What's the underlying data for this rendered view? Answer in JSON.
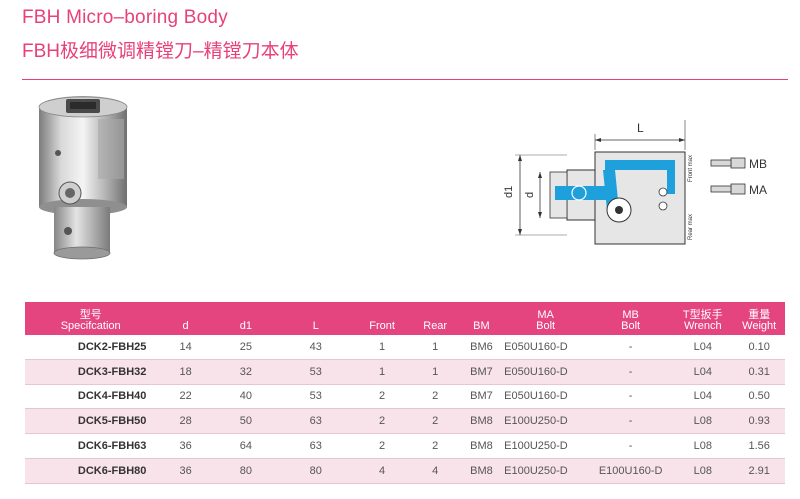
{
  "title_en": "FBH Micro–boring Body",
  "title_cn": "FBH极细微调精镗刀–精镗刀本体",
  "diagram": {
    "label_L": "L",
    "label_d1": "d1",
    "label_d": "d",
    "label_MB": "MB",
    "label_MA": "MA",
    "label_front_max": "Front max",
    "label_rear_max": "Rear max"
  },
  "table": {
    "headers": [
      {
        "cn": "型号",
        "en": "Specifcation"
      },
      {
        "cn": "",
        "en": "d"
      },
      {
        "cn": "",
        "en": "d1"
      },
      {
        "cn": "",
        "en": "L"
      },
      {
        "cn": "",
        "en": "Front"
      },
      {
        "cn": "",
        "en": "Rear"
      },
      {
        "cn": "",
        "en": "BM"
      },
      {
        "cn": "MA",
        "en": "Bolt"
      },
      {
        "cn": "MB",
        "en": "Bolt"
      },
      {
        "cn": "T型扳手",
        "en": "Wrench"
      },
      {
        "cn": "重量",
        "en": "Weight"
      }
    ],
    "rows": [
      [
        "DCK2-FBH25",
        "14",
        "25",
        "43",
        "1",
        "1",
        "BM6",
        "E050U160-D",
        "-",
        "L04",
        "0.10"
      ],
      [
        "DCK3-FBH32",
        "18",
        "32",
        "53",
        "1",
        "1",
        "BM7",
        "E050U160-D",
        "-",
        "L04",
        "0.31"
      ],
      [
        "DCK4-FBH40",
        "22",
        "40",
        "53",
        "2",
        "2",
        "BM7",
        "E050U160-D",
        "-",
        "L04",
        "0.50"
      ],
      [
        "DCK5-FBH50",
        "28",
        "50",
        "63",
        "2",
        "2",
        "BM8",
        "E100U250-D",
        "-",
        "L08",
        "0.93"
      ],
      [
        "DCK6-FBH63",
        "36",
        "64",
        "63",
        "2",
        "2",
        "BM8",
        "E100U250-D",
        "-",
        "L08",
        "1.56"
      ],
      [
        "DCK6-FBH80",
        "36",
        "80",
        "80",
        "4",
        "4",
        "BM8",
        "E100U250-D",
        "E100U160-D",
        "L08",
        "2.91"
      ]
    ]
  }
}
